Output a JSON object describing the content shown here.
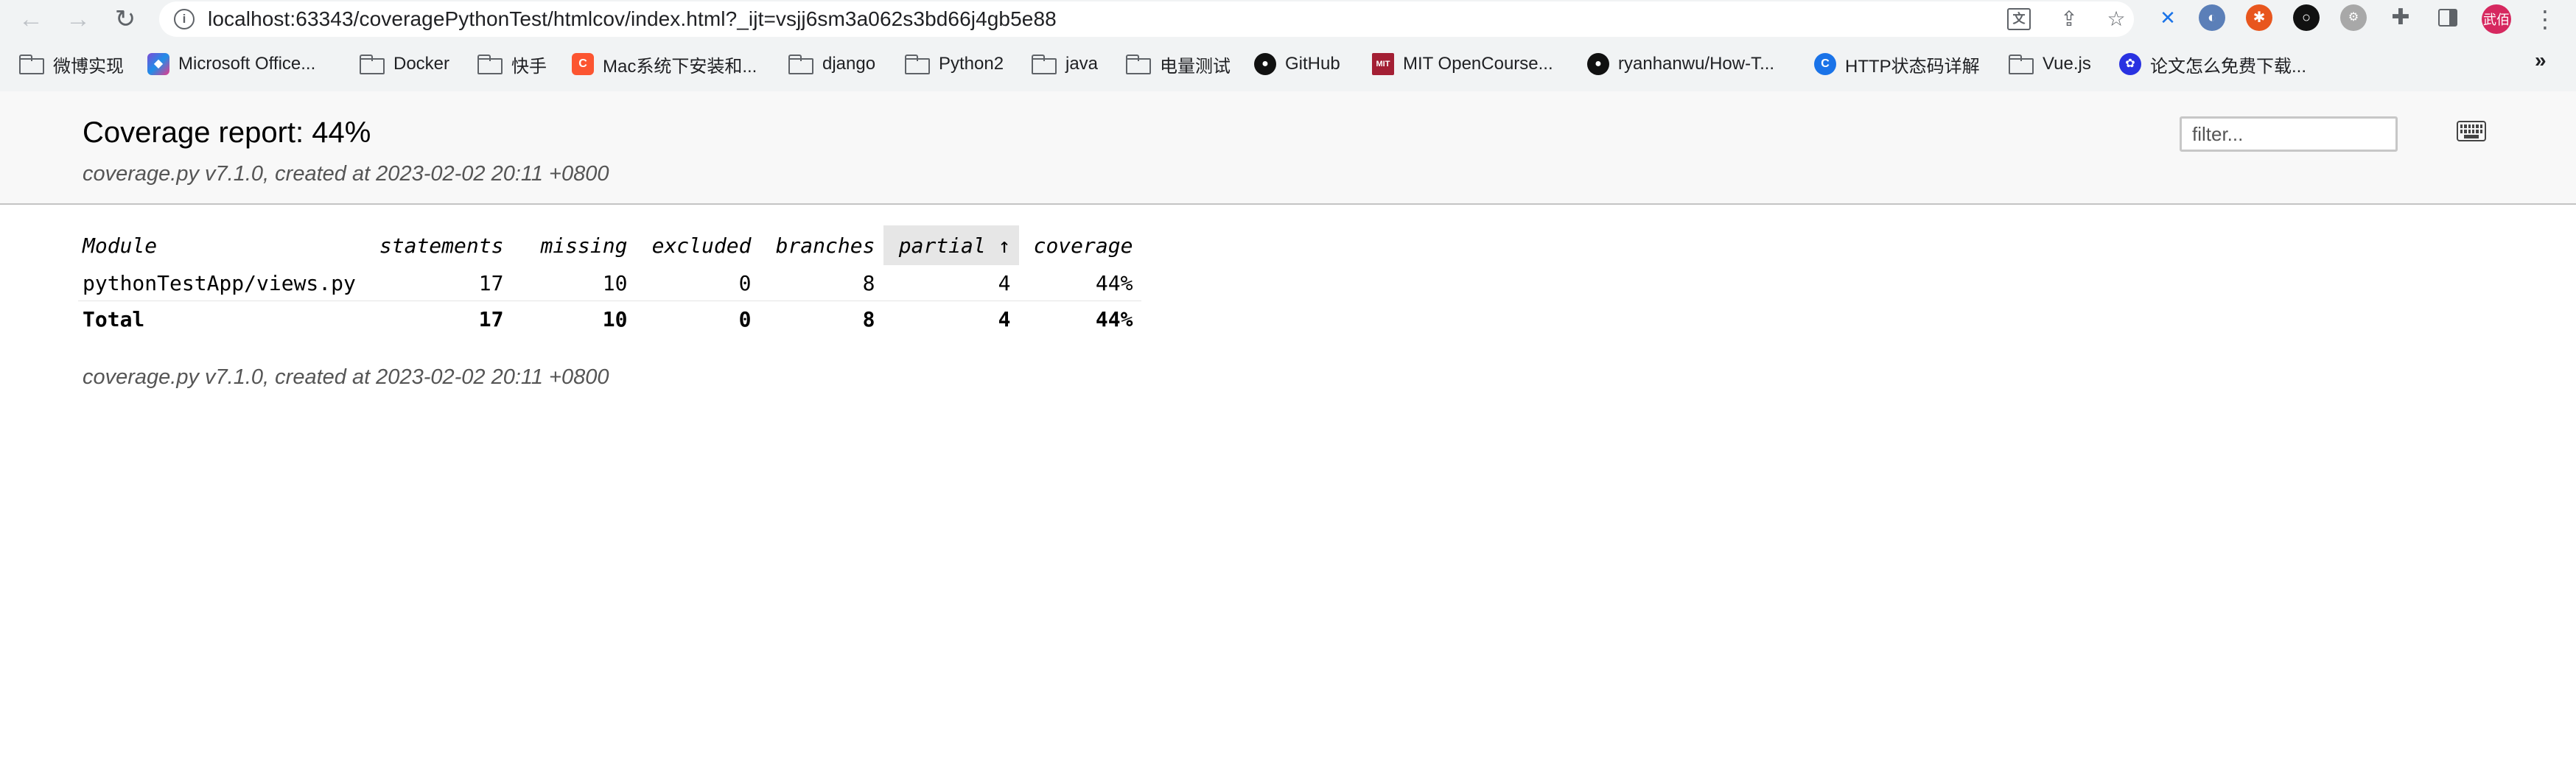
{
  "browser": {
    "url": "localhost:63343/coveragePythonTest/htmlcov/index.html?_ijt=vsjj6sm3a062s3bd66j4gb5e88",
    "profile_initials": "武佰",
    "bookmarks": [
      {
        "label": "微博实现",
        "icon": "folder-icon"
      },
      {
        "label": "Microsoft Office...",
        "icon": "microsoft-office-icon"
      },
      {
        "label": "Docker",
        "icon": "folder-icon"
      },
      {
        "label": "快手",
        "icon": "folder-icon"
      },
      {
        "label": "Mac系统下安装和...",
        "icon": "csdn-icon"
      },
      {
        "label": "django",
        "icon": "folder-icon"
      },
      {
        "label": "Python2",
        "icon": "folder-icon"
      },
      {
        "label": "java",
        "icon": "folder-icon"
      },
      {
        "label": "电量测试",
        "icon": "folder-icon"
      },
      {
        "label": "GitHub",
        "icon": "github-icon"
      },
      {
        "label": "MIT OpenCourse...",
        "icon": "mit-ocw-icon"
      },
      {
        "label": "ryanhanwu/How-T...",
        "icon": "github-icon"
      },
      {
        "label": "HTTP状态码详解",
        "icon": "chrome-c-icon"
      },
      {
        "label": "Vue.js",
        "icon": "folder-icon"
      },
      {
        "label": "论文怎么免费下载...",
        "icon": "baidu-icon"
      }
    ],
    "more_label": "»"
  },
  "report": {
    "title": "Coverage report: 44%",
    "subtitle": "coverage.py v7.1.0, created at 2023-02-02 20:11 +0800",
    "filter_placeholder": "filter...",
    "columns": {
      "module": "Module",
      "statements": "statements",
      "missing": "missing",
      "excluded": "excluded",
      "branches": "branches",
      "partial": "partial ↑",
      "coverage": "coverage"
    },
    "rows": [
      {
        "module": "pythonTestApp/views.py",
        "statements": "17",
        "missing": "10",
        "excluded": "0",
        "branches": "8",
        "partial": "4",
        "coverage": "44%"
      }
    ],
    "total": {
      "module": "Total",
      "statements": "17",
      "missing": "10",
      "excluded": "0",
      "branches": "8",
      "partial": "4",
      "coverage": "44%"
    },
    "footer": "coverage.py v7.1.0, created at 2023-02-02 20:11 +0800"
  }
}
